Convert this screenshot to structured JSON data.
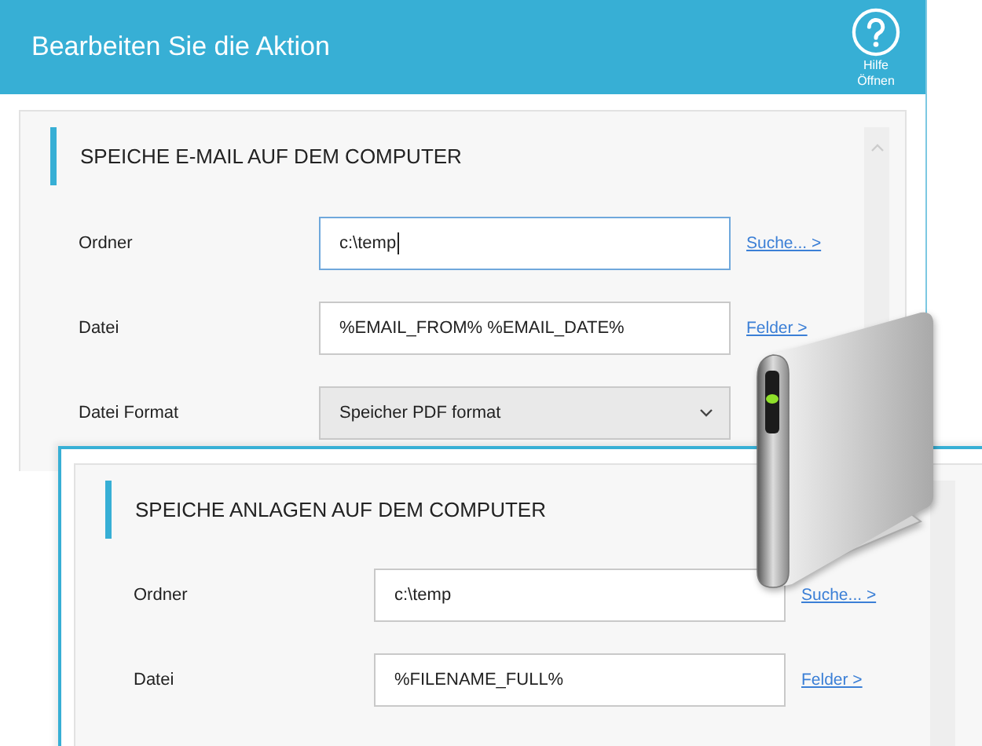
{
  "windows": [
    {
      "title": "Bearbeiten Sie die Aktion",
      "help": {
        "line_1": "Hilfe",
        "line_2": "Öffnen"
      },
      "section": "SPEICHE E-MAIL AUF DEM COMPUTER",
      "rows": [
        {
          "kind": "text",
          "label": "Ordner",
          "value": "c:\\temp",
          "focused": true,
          "link": "Suche... >"
        },
        {
          "kind": "text",
          "label": "Datei",
          "value": "%EMAIL_FROM% %EMAIL_DATE%",
          "focused": false,
          "link": "Felder >"
        },
        {
          "kind": "select",
          "label": "Datei Format",
          "value": "Speicher PDF format"
        }
      ]
    },
    {
      "section": "SPEICHE ANLAGEN AUF DEM COMPUTER",
      "rows": [
        {
          "kind": "text",
          "label": "Ordner",
          "value": "c:\\temp",
          "focused": false,
          "link": "Suche... >"
        },
        {
          "kind": "text",
          "label": "Datei",
          "value": "%FILENAME_FULL%",
          "focused": false,
          "link": "Felder >"
        }
      ]
    }
  ]
}
